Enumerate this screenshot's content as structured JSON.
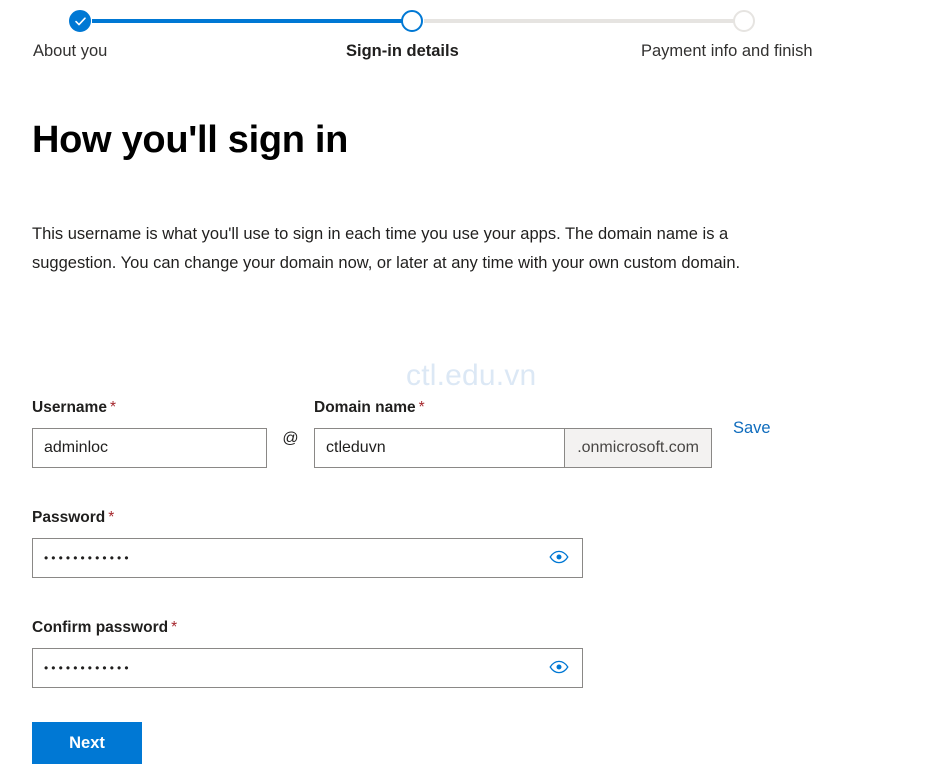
{
  "stepper": {
    "steps": [
      {
        "label": "About you",
        "state": "done"
      },
      {
        "label": "Sign-in details",
        "state": "current"
      },
      {
        "label": "Payment info and finish",
        "state": "future"
      }
    ],
    "active_color": "#0078d4",
    "inactive_color": "#e6e4e1"
  },
  "page": {
    "title": "How you'll sign in",
    "intro": "This username is what you'll use to sign in each time you use your apps. The domain name is a suggestion. You can change your domain now, or later at any time with your own custom domain.",
    "watermark": "ctl.edu.vn"
  },
  "form": {
    "username": {
      "label": "Username",
      "required_marker": "*",
      "value": "adminloc"
    },
    "at_separator": "@",
    "domain": {
      "label": "Domain name",
      "required_marker": "*",
      "value": "ctleduvn",
      "suffix": ".onmicrosoft.com"
    },
    "save_link": "Save",
    "password": {
      "label": "Password",
      "required_marker": "*",
      "masked_value": "••••••••••••",
      "reveal_icon": "eye-icon"
    },
    "confirm_password": {
      "label": "Confirm password",
      "required_marker": "*",
      "masked_value": "••••••••••••",
      "reveal_icon": "eye-icon"
    },
    "next_button": "Next",
    "accent_color": "#0078d4",
    "required_color": "#a4262c",
    "link_color": "#0f6cbd"
  }
}
